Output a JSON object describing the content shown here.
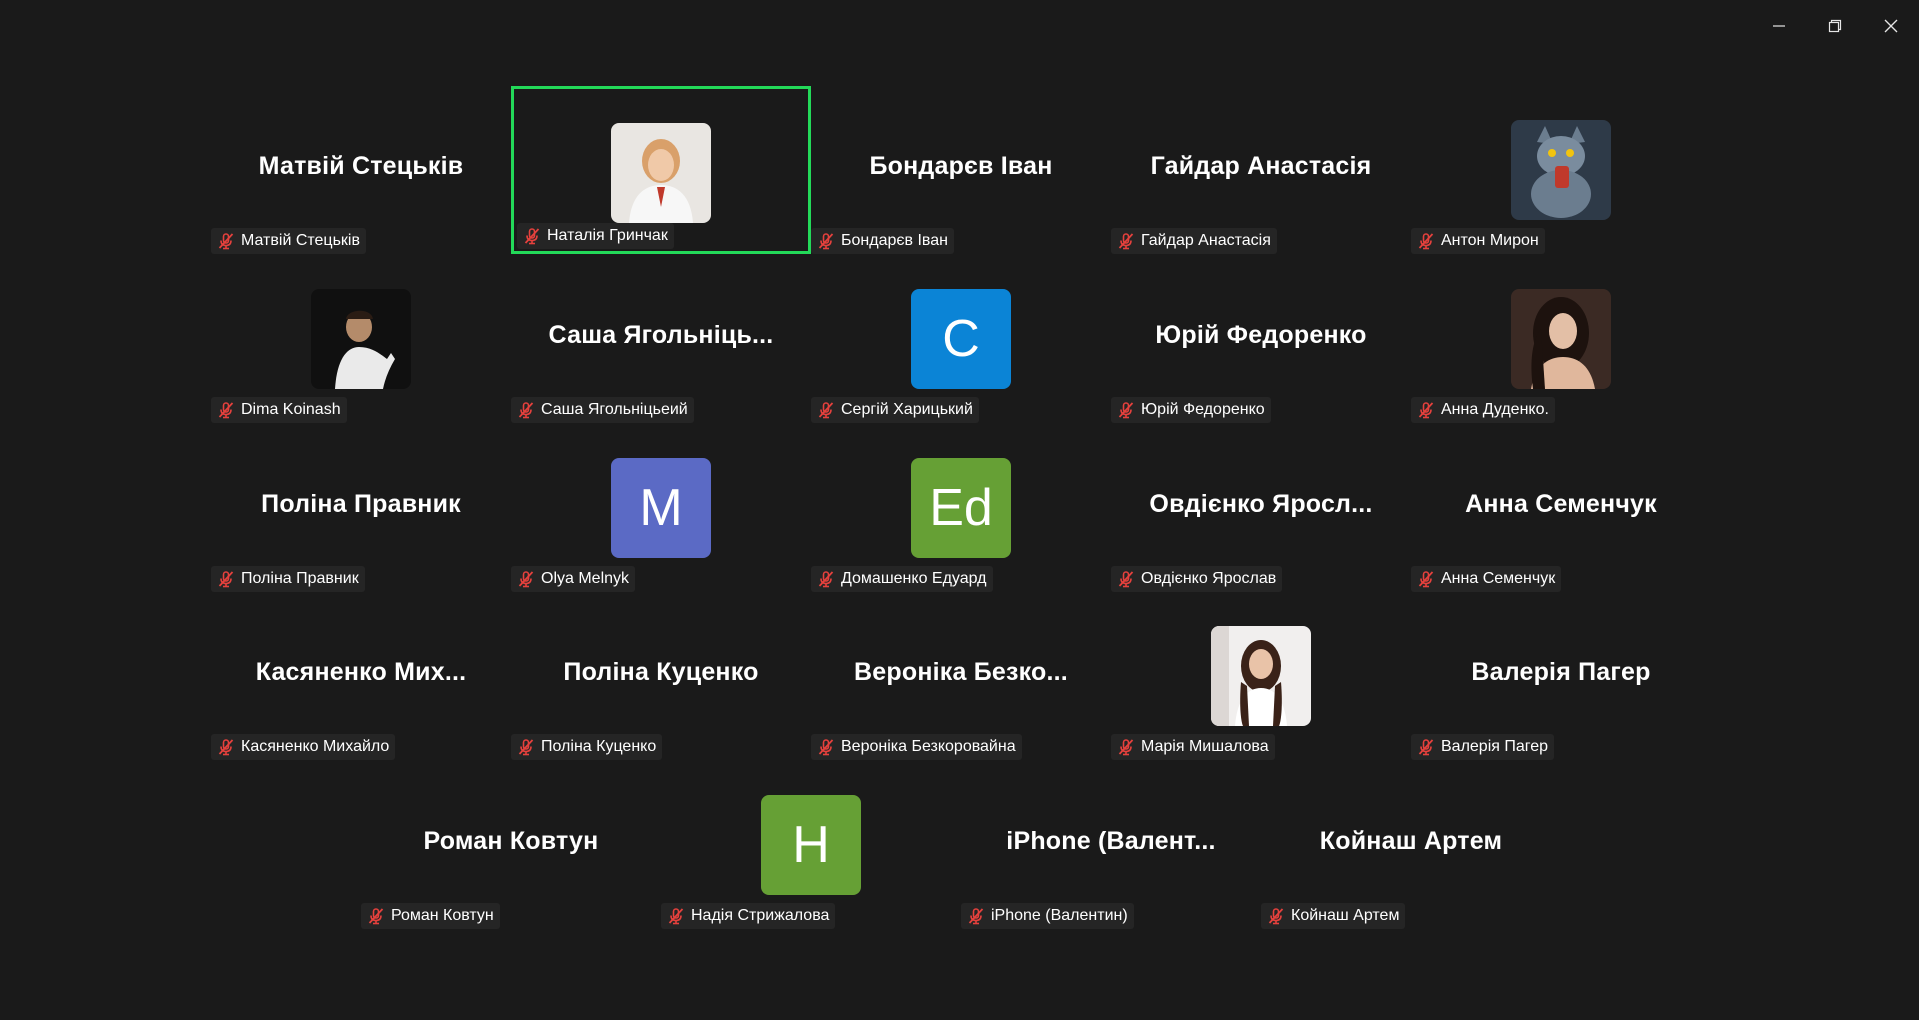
{
  "window": {
    "controls": [
      "minimize",
      "restore",
      "close"
    ]
  },
  "colors": {
    "background": "#1a1a1a",
    "active_speaker_border": "#23d959",
    "muted_icon": "#e5413d",
    "label_bg": "#262626"
  },
  "participants": [
    {
      "display": "Матвій Стецьків",
      "label": "Матвій Стецьків",
      "type": "name"
    },
    {
      "display": "",
      "label": "Наталія Гринчак",
      "type": "photo",
      "photo": "woman-white-blouse",
      "active": true
    },
    {
      "display": "Бондарєв Іван",
      "label": "Бондарєв Іван",
      "type": "name"
    },
    {
      "display": "Гайдар Анастасія",
      "label": "Гайдар Анастасія",
      "type": "name"
    },
    {
      "display": "",
      "label": "Антон Мирон",
      "type": "photo",
      "photo": "cartoon-cat"
    },
    {
      "display": "",
      "label": "Dima Koinash",
      "type": "photo",
      "photo": "man-dark-background"
    },
    {
      "display": "Саша  Ягольніць...",
      "label": "Саша Ягольніцьеий",
      "type": "name"
    },
    {
      "display": "C",
      "label": "Сергій Харицький",
      "type": "letter",
      "color": "#0b84d6"
    },
    {
      "display": "Юрій Федоренко",
      "label": "Юрій Федоренко",
      "type": "name"
    },
    {
      "display": "",
      "label": "Анна Дуденко.",
      "type": "photo",
      "photo": "woman-dark-hair"
    },
    {
      "display": "Поліна Правник",
      "label": "Поліна Правник",
      "type": "name"
    },
    {
      "display": "M",
      "label": "Olya Melnyk",
      "type": "letter",
      "color": "#5b6ac5"
    },
    {
      "display": "Ed",
      "label": "Домашенко Едуард",
      "type": "letter",
      "color": "#66a035"
    },
    {
      "display": "Овдієнко  Яросл...",
      "label": "Овдієнко Ярослав",
      "type": "name"
    },
    {
      "display": "Анна Семенчук",
      "label": "Анна Семенчук",
      "type": "name"
    },
    {
      "display": "Касяненко  Мих...",
      "label": "Касяненко Михайло",
      "type": "name"
    },
    {
      "display": "Поліна Куценко",
      "label": "Поліна Куценко",
      "type": "name"
    },
    {
      "display": "Вероніка  Безко...",
      "label": "Вероніка Безкоровайна",
      "type": "name"
    },
    {
      "display": "",
      "label": "Марія Мишалова",
      "type": "photo",
      "photo": "girl-light-room"
    },
    {
      "display": "Валерія Пагер",
      "label": "Валерія Пагер",
      "type": "name"
    },
    {
      "display": "Роман Ковтун",
      "label": "Роман Ковтун",
      "type": "name"
    },
    {
      "display": "H",
      "label": "Надія Стрижалова",
      "type": "letter",
      "color": "#66a035"
    },
    {
      "display": "iPhone  (Валент...",
      "label": "iPhone (Валентин)",
      "type": "name"
    },
    {
      "display": "Койнаш Артем",
      "label": "Койнаш Артем",
      "type": "name"
    }
  ]
}
